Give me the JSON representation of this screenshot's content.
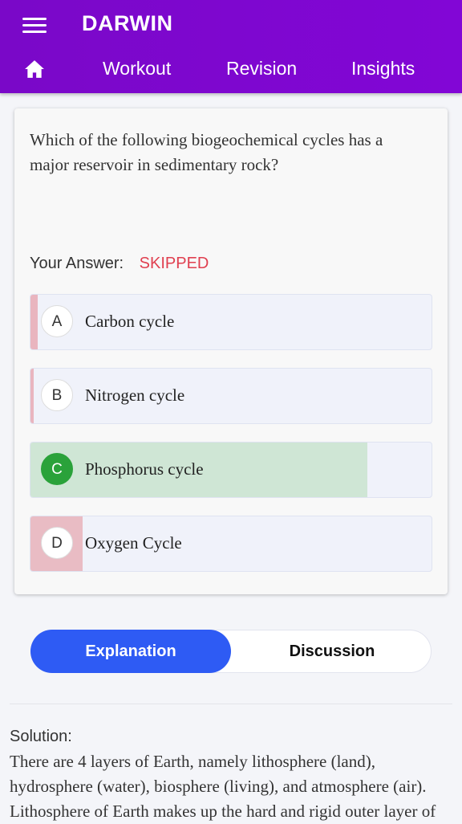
{
  "app": {
    "title": "DARWIN"
  },
  "nav": {
    "tabs": [
      "Workout",
      "Revision",
      "Insights"
    ]
  },
  "question": {
    "text": "Which of the following biogeochemical cycles has a major reservoir in sedimentary rock?",
    "your_answer_label": "Your Answer:",
    "your_answer_value": "SKIPPED",
    "options": [
      {
        "letter": "A",
        "text": "Carbon cycle"
      },
      {
        "letter": "B",
        "text": "Nitrogen cycle"
      },
      {
        "letter": "C",
        "text": "Phosphorus cycle",
        "correct": true
      },
      {
        "letter": "D",
        "text": "Oxygen Cycle"
      }
    ]
  },
  "tabs": {
    "explanation": "Explanation",
    "discussion": "Discussion",
    "active": "Explanation"
  },
  "solution": {
    "title": "Solution:",
    "text": "There are 4 layers of Earth, namely lithosphere (land), hydrosphere (water), biosphere (living), and atmosphere (air). Lithosphere of Earth makes up the hard and rigid outer layer of"
  },
  "colors": {
    "appbar": "#7a08c8",
    "skipped": "#e04050",
    "correct": "#2aa23a",
    "active_tab": "#2e5bf4"
  }
}
